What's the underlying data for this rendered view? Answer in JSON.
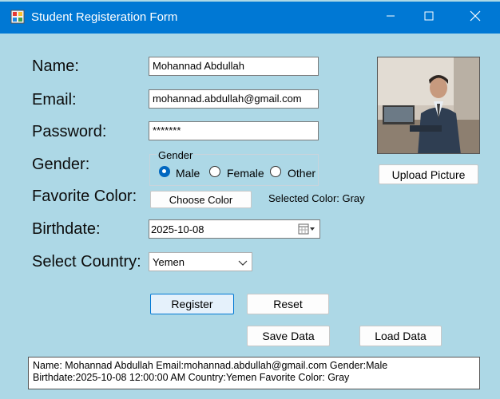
{
  "window": {
    "title": "Student Registeration Form",
    "icon": "form-app-icon"
  },
  "form": {
    "name_label": "Name:",
    "email_label": "Email:",
    "password_label": "Password:",
    "gender_label": "Gender:",
    "color_label": "Favorite Color:",
    "birthdate_label": "Birthdate:",
    "country_label": "Select Country:",
    "name_value": "Mohannad Abdullah",
    "email_value": "mohannad.abdullah@gmail.com",
    "password_value": "*******",
    "gender_group_title": "Gender",
    "gender_options": [
      "Male",
      "Female",
      "Other"
    ],
    "gender_selected": "Male",
    "choose_color_label": "Choose Color",
    "selected_color_text": "Selected Color: Gray",
    "birthdate_value": "2025-10-08",
    "country_value": "Yemen"
  },
  "buttons": {
    "upload_picture": "Upload Picture",
    "register": "Register",
    "reset": "Reset",
    "save_data": "Save Data",
    "load_data": "Load Data"
  },
  "output": {
    "line1": "Name: Mohannad Abdullah Email:mohannad.abdullah@gmail.com Gender:Male",
    "line2": "Birthdate:2025-10-08 12:00:00 AM Country:Yemen Favorite Color: Gray"
  },
  "colors": {
    "titlebar": "#0078d4",
    "form_background": "#add8e6",
    "accent": "#0067c0"
  },
  "icons": [
    "form-app-icon",
    "minimize-icon",
    "maximize-icon",
    "close-icon",
    "calendar-icon",
    "chevron-down-icon"
  ]
}
